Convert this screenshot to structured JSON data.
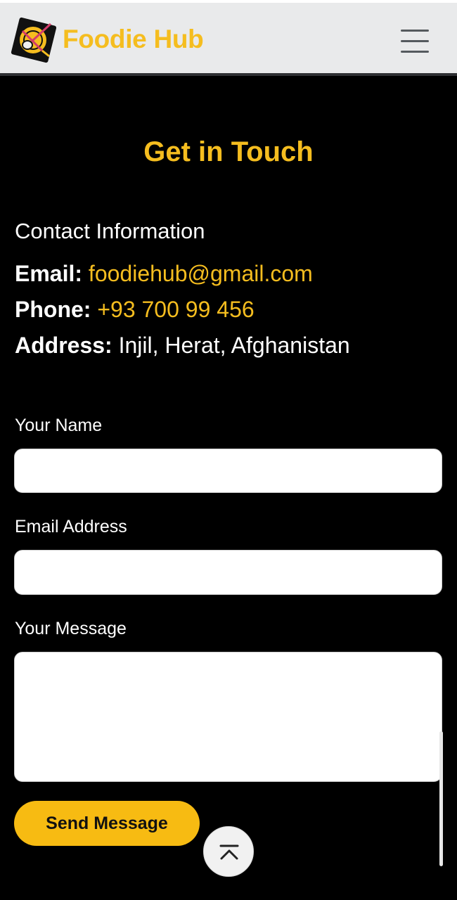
{
  "header": {
    "brand": "Foodie Hub",
    "logo_icon": "plate-fork-spoon-logo-icon",
    "menu_icon": "hamburger-menu-icon"
  },
  "section": {
    "title": "Get in Touch"
  },
  "contact": {
    "heading": "Contact Information",
    "email_label": "Email:",
    "email_value": "foodiehub@gmail.com",
    "phone_label": "Phone:",
    "phone_value": "+93 700 99 456",
    "address_label": "Address:",
    "address_value": "Injil, Herat, Afghanistan"
  },
  "form": {
    "name_label": "Your Name",
    "name_value": "",
    "email_label": "Email Address",
    "email_value": "",
    "message_label": "Your Message",
    "message_value": "",
    "submit_label": "Send Message"
  },
  "scroll_top": {
    "icon": "chevron-up-to-top-icon"
  },
  "colors": {
    "accent": "#f5bd1f",
    "button": "#f7bb12",
    "header_bg": "#e9eaeb",
    "page_bg": "#000000"
  }
}
